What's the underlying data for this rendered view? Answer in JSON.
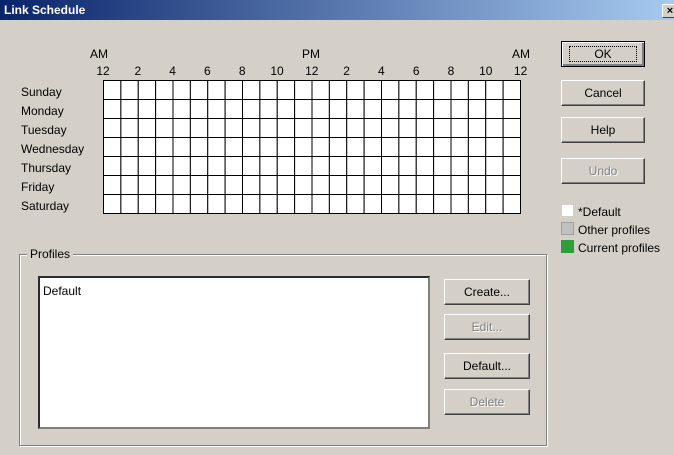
{
  "window": {
    "title": "Link Schedule",
    "close_glyph": "×"
  },
  "schedule": {
    "am_start_label": "AM",
    "pm_label": "PM",
    "am_end_label": "AM",
    "hour_ticks": [
      "12",
      "2",
      "4",
      "6",
      "8",
      "10",
      "12",
      "2",
      "4",
      "6",
      "8",
      "10",
      "12"
    ],
    "days": [
      "Sunday",
      "Monday",
      "Tuesday",
      "Wednesday",
      "Thursday",
      "Friday",
      "Saturday"
    ],
    "grid_columns": 24
  },
  "buttons": {
    "ok": "OK",
    "cancel": "Cancel",
    "help": "Help",
    "undo": "Undo"
  },
  "legend": {
    "default_label": "*Default",
    "default_color": "#ffffff",
    "other_label": "Other profiles",
    "other_color": "#c0c0c0",
    "current_label": "Current profiles",
    "current_color": "#2e9e3a"
  },
  "profiles": {
    "group_label": "Profiles",
    "items": [
      "Default"
    ],
    "create": "Create...",
    "edit": "Edit...",
    "default": "Default...",
    "delete": "Delete"
  }
}
